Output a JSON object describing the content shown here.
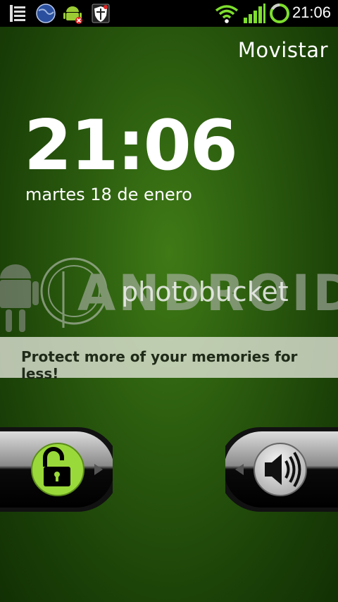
{
  "status_bar": {
    "time": "21:06",
    "left_icons": [
      "menu-lines-icon",
      "globe-icon",
      "android-update-icon",
      "shield-app-icon"
    ],
    "right_icons": [
      "wifi-icon",
      "signal-bars-icon",
      "sync-ring-icon"
    ]
  },
  "lockscreen": {
    "carrier": "Movistar",
    "clock": "21:06",
    "date": "martes 18 de enero"
  },
  "watermark": {
    "brand": "photobucket",
    "logo_text": "ANDROID",
    "promo": "Protect more of your memories for less!"
  },
  "controls": {
    "unlock_icon": "padlock-open-icon",
    "sound_icon": "speaker-volume-icon",
    "unlock_color": "#9ad93a"
  }
}
